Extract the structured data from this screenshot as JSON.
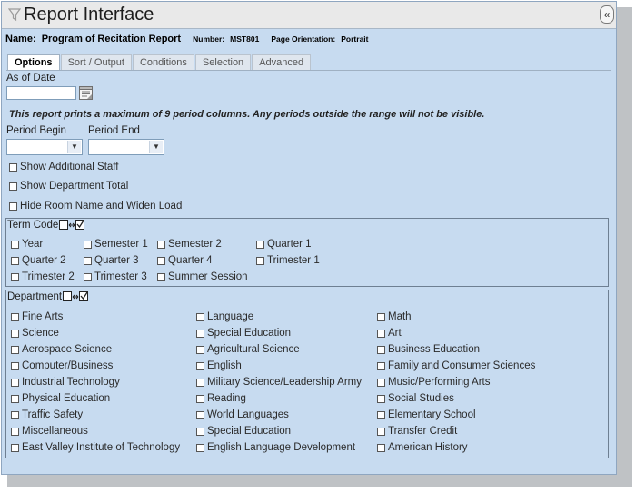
{
  "window": {
    "title": "Report Interface",
    "collapse_label": "«"
  },
  "report": {
    "name_label": "Name:",
    "name_value": "Program of Recitation Report",
    "number_label": "Number:",
    "number_value": "MST801",
    "orientation_label": "Page Orientation:",
    "orientation_value": "Portrait"
  },
  "tabs": [
    {
      "label": "Options",
      "active": true
    },
    {
      "label": "Sort / Output",
      "active": false
    },
    {
      "label": "Conditions",
      "active": false
    },
    {
      "label": "Selection",
      "active": false
    },
    {
      "label": "Advanced",
      "active": false
    }
  ],
  "options": {
    "as_of_date_label": "As of Date",
    "as_of_date_value": "",
    "note": "This report prints a maximum of 9 period columns. Any periods outside the range will not be visible.",
    "period_begin_label": "Period Begin",
    "period_begin_value": "",
    "period_end_label": "Period End",
    "period_end_value": "",
    "checkboxes": [
      {
        "label": "Show Additional Staff",
        "checked": false
      },
      {
        "label": "Show Department Total",
        "checked": false
      },
      {
        "label": "Hide Room Name and Widen Load",
        "checked": false
      }
    ]
  },
  "term_code": {
    "title": "Term Code",
    "items": [
      "Year",
      "Semester 1",
      "Semester 2",
      "Quarter 1",
      "Quarter 2",
      "Quarter 3",
      "Quarter 4",
      "Trimester 1",
      "Trimester 2",
      "Trimester 3",
      "Summer Session"
    ]
  },
  "department": {
    "title": "Department",
    "items": [
      "Fine Arts",
      "Language",
      "Math",
      "Science",
      "Special Education",
      "Art",
      "Aerospace Science",
      "Agricultural Science",
      "Business Education",
      "Computer/Business",
      "English",
      "Family and Consumer Sciences",
      "Industrial Technology",
      "Military Science/Leadership Army",
      "Music/Performing Arts",
      "Physical Education",
      "Reading",
      "Social Studies",
      "Traffic Safety",
      "World Languages",
      "Elementary School",
      "Miscellaneous",
      "Special Education",
      "Transfer Credit",
      "East Valley Institute of Technology",
      "English Language Development",
      "American History"
    ]
  }
}
